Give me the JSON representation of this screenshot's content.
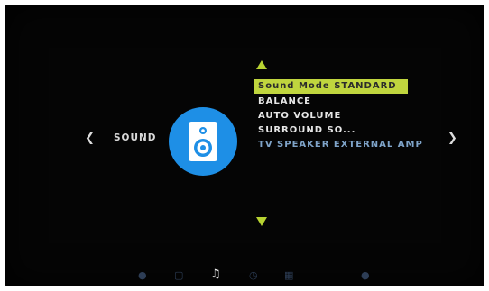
{
  "nav": {
    "left_arrow": "❮",
    "right_arrow": "❯"
  },
  "category": {
    "label": "SOUND",
    "icon": "speaker-icon",
    "accent_color": "#1e8fe6"
  },
  "menu": {
    "highlight_color": "#c0d53e",
    "items": [
      {
        "label": "Sound Mode STANDARD",
        "selected": true
      },
      {
        "label": "BALANCE"
      },
      {
        "label": "AUTO VOLUME"
      },
      {
        "label": "SURROUND SO..."
      },
      {
        "label": "TV SPEAKER EXTERNAL AMP",
        "dim": true
      }
    ]
  },
  "bottom_icons": [
    {
      "name": "picture-icon",
      "glyph": "●"
    },
    {
      "name": "channel-icon",
      "glyph": "▢"
    },
    {
      "name": "music-note-icon",
      "glyph": "♫",
      "active": true
    },
    {
      "name": "clock-icon",
      "glyph": "◷"
    },
    {
      "name": "grid-icon",
      "glyph": "▦"
    },
    {
      "name": "settings-icon",
      "glyph": "●"
    }
  ]
}
